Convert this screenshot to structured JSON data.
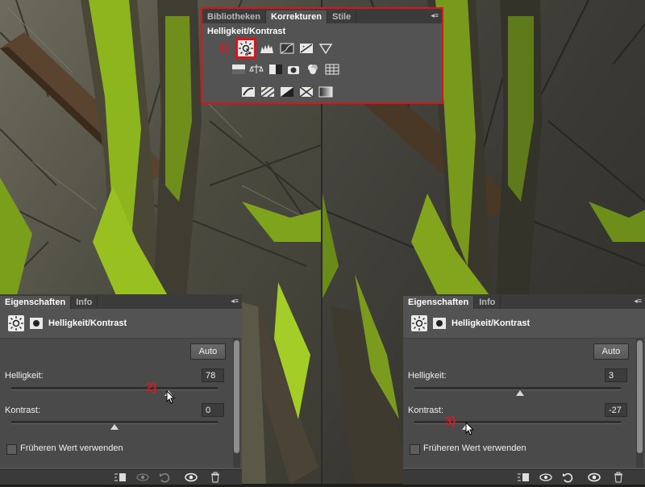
{
  "adjustments_panel": {
    "tabs": [
      "Bibliotheken",
      "Korrekturen",
      "Stile"
    ],
    "active_tab": "Korrekturen",
    "title": "Helligkeit/Kontrast",
    "step_marker": "1)",
    "menu_icon": "panel-menu-icon",
    "icons_row1": [
      "brightness-contrast-icon",
      "levels-icon",
      "curves-icon",
      "exposure-icon",
      "vibrance-icon"
    ],
    "icons_row2": [
      "hue-saturation-icon",
      "color-balance-icon",
      "black-white-icon",
      "photo-filter-icon",
      "channel-mixer-icon",
      "color-lookup-icon"
    ],
    "icons_row3": [
      "invert-icon",
      "posterize-icon",
      "threshold-icon",
      "selective-color-icon",
      "gradient-map-icon"
    ]
  },
  "properties_left": {
    "tabs": [
      "Eigenschaften",
      "Info"
    ],
    "subtitle": "Helligkeit/Kontrast",
    "auto_label": "Auto",
    "brightness_label": "Helligkeit:",
    "brightness_value": "78",
    "brightness_slider": 0.76,
    "contrast_label": "Kontrast:",
    "contrast_value": "0",
    "contrast_slider": 0.5,
    "legacy_label": "Früheren Wert verwenden",
    "step_marker": "2)"
  },
  "properties_right": {
    "tabs": [
      "Eigenschaften",
      "Info"
    ],
    "subtitle": "Helligkeit/Kontrast",
    "auto_label": "Auto",
    "brightness_label": "Helligkeit:",
    "brightness_value": "3",
    "brightness_slider": 0.51,
    "contrast_label": "Kontrast:",
    "contrast_value": "-27",
    "contrast_slider": 0.25,
    "legacy_label": "Früheren Wert verwenden",
    "step_marker": "3)"
  },
  "bottom_icons": [
    "clip-to-layer-icon",
    "view-previous-icon",
    "reset-icon",
    "visibility-eye-icon",
    "trash-icon"
  ],
  "colors": {
    "moss": "#8cb51e",
    "highlight_red": "#e30f14",
    "panel": "#535353"
  }
}
